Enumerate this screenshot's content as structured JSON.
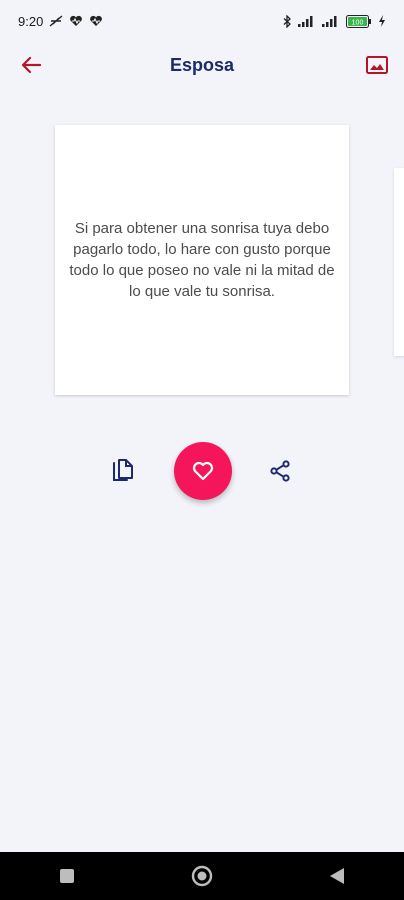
{
  "status_bar": {
    "time": "9:20",
    "icons": [
      "no-data-icon",
      "heartbeat-icon",
      "heartbeat-icon",
      "bluetooth-icon",
      "signal-icon",
      "signal-icon",
      "battery-icon",
      "charging-icon"
    ],
    "battery_level": "100"
  },
  "app_bar": {
    "title": "Esposa",
    "back_icon": "arrow-left-icon",
    "image_icon": "image-icon",
    "accent": "#b0172a"
  },
  "quote": {
    "text": "Si para obtener una sonrisa tuya debo pagarlo todo, lo hare con gusto porque todo lo que poseo no vale ni la mitad de lo que vale tu sonrisa."
  },
  "actions": {
    "copy_icon": "copy-icon",
    "favorite_icon": "heart-icon",
    "share_icon": "share-icon",
    "favorite_color": "#f5155b"
  },
  "nav_bar": {
    "items": [
      "recents-square-icon",
      "home-circle-icon",
      "back-triangle-icon"
    ]
  }
}
